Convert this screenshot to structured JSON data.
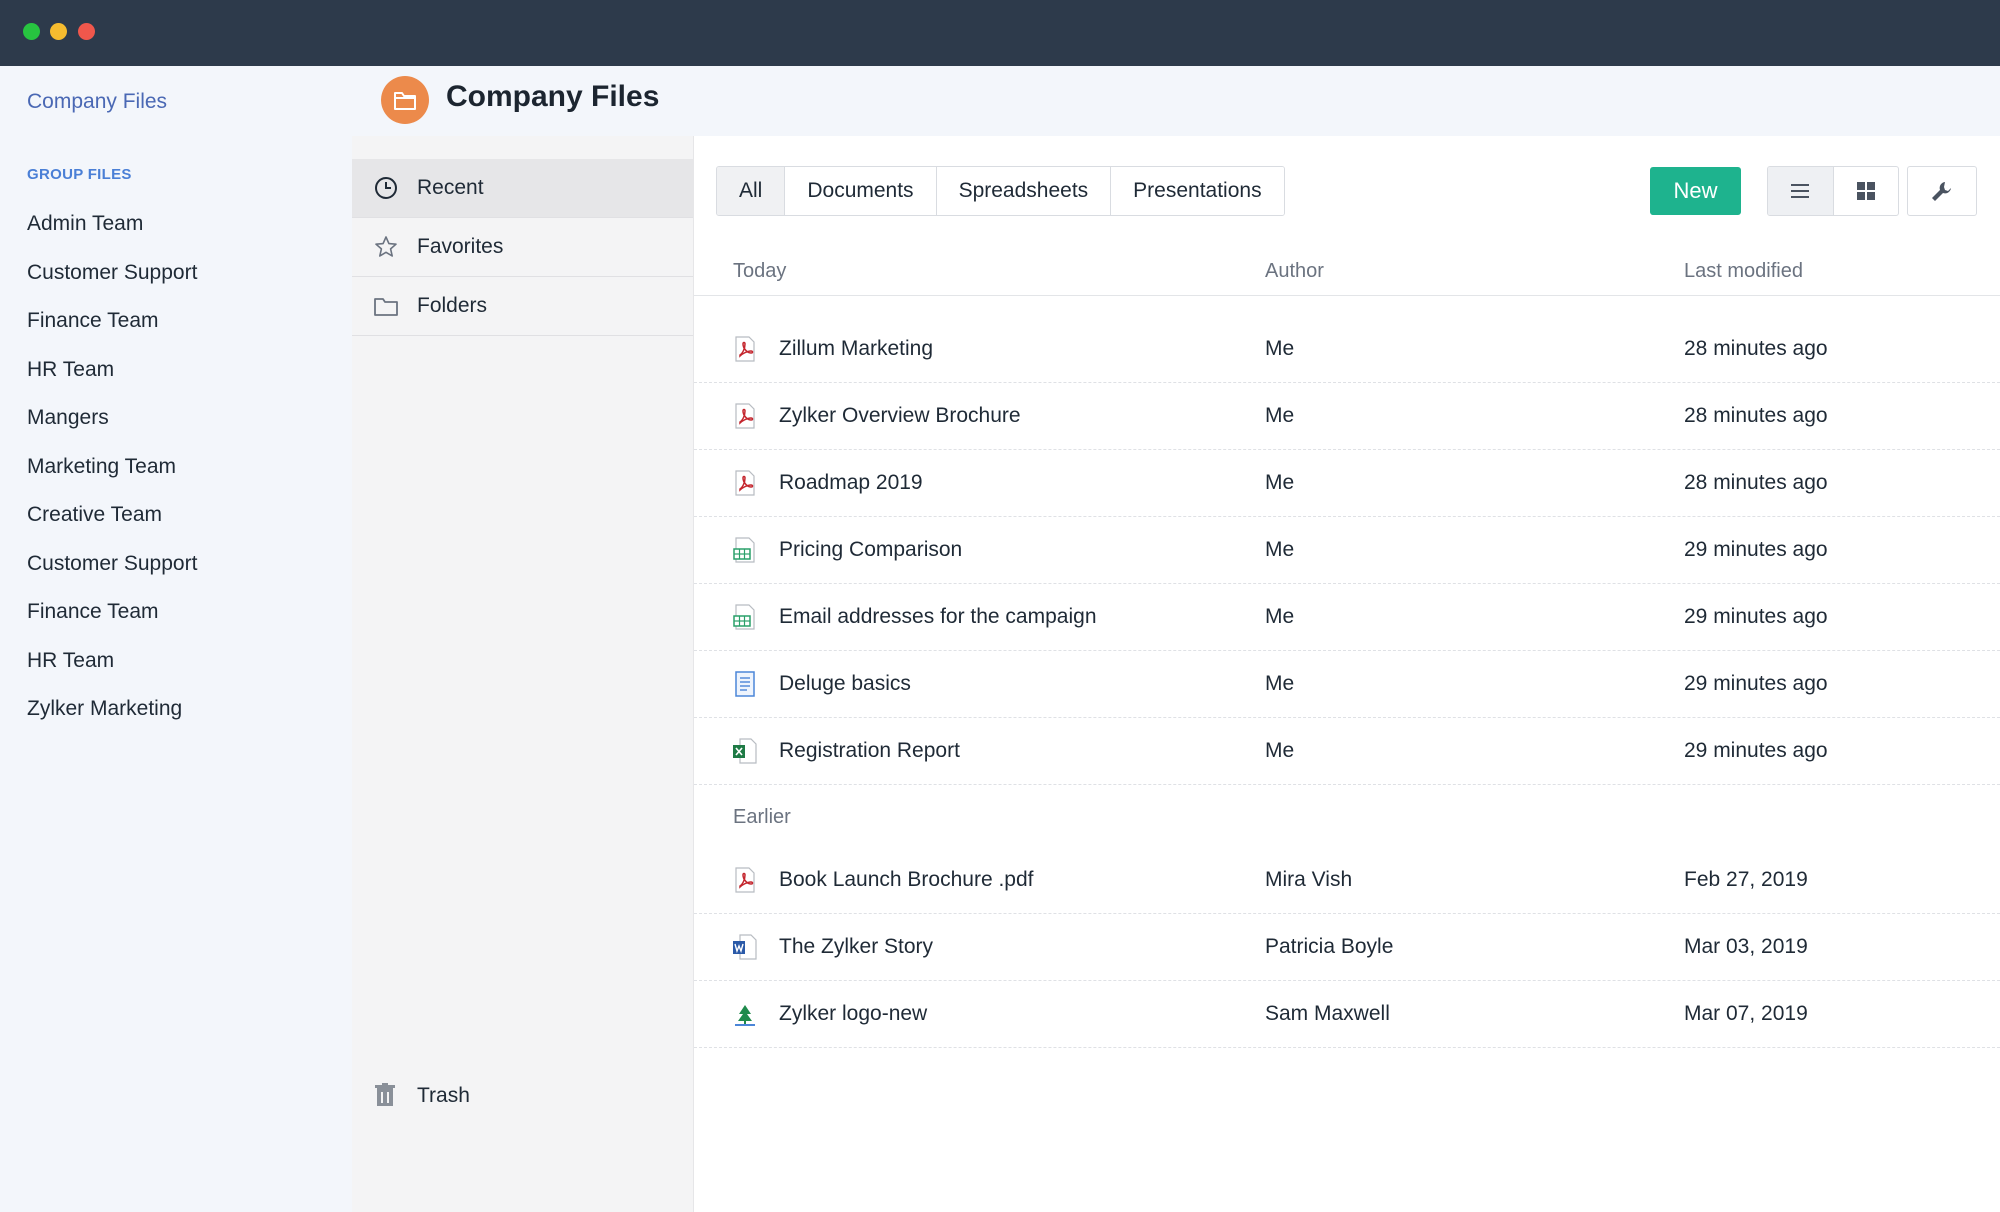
{
  "window": {
    "controls": [
      "close",
      "minimize",
      "maximize"
    ]
  },
  "sidebar": {
    "brand": "Company Files",
    "group_title": "GROUP FILES",
    "items": [
      {
        "label": "Admin Team"
      },
      {
        "label": "Customer Support"
      },
      {
        "label": "Finance Team"
      },
      {
        "label": "HR Team"
      },
      {
        "label": "Mangers"
      },
      {
        "label": "Marketing Team"
      },
      {
        "label": "Creative Team"
      },
      {
        "label": "Customer Support"
      },
      {
        "label": "Finance Team"
      },
      {
        "label": "HR Team"
      },
      {
        "label": "Zylker Marketing"
      }
    ]
  },
  "header": {
    "title": "Company Files",
    "icon": "folder-icon",
    "accent": "#ec8a4b"
  },
  "midnav": {
    "items": [
      {
        "label": "Recent",
        "icon": "clock-icon",
        "active": true
      },
      {
        "label": "Favorites",
        "icon": "star-icon",
        "active": false
      },
      {
        "label": "Folders",
        "icon": "folder-icon",
        "active": false
      }
    ],
    "trash": {
      "label": "Trash",
      "icon": "trash-icon"
    }
  },
  "toolbar": {
    "tabs": [
      {
        "label": "All",
        "active": true
      },
      {
        "label": "Documents",
        "active": false
      },
      {
        "label": "Spreadsheets",
        "active": false
      },
      {
        "label": "Presentations",
        "active": false
      }
    ],
    "new_label": "New",
    "new_color": "#1eb38e",
    "view_modes": [
      "list-view-icon",
      "grid-view-icon"
    ],
    "settings_icon": "wrench-icon"
  },
  "table": {
    "columns": {
      "name": "Today",
      "author": "Author",
      "modified": "Last modified"
    },
    "sections": [
      {
        "label": "Today",
        "rows": [
          {
            "name": "Zillum Marketing",
            "author": "Me",
            "modified": "28 minutes ago",
            "icon": "pdf-file-icon"
          },
          {
            "name": "Zylker Overview Brochure",
            "author": "Me",
            "modified": "28 minutes ago",
            "icon": "pdf-file-icon"
          },
          {
            "name": "Roadmap 2019",
            "author": "Me",
            "modified": "28 minutes ago",
            "icon": "pdf-file-icon"
          },
          {
            "name": "Pricing Comparison",
            "author": "Me",
            "modified": "29 minutes ago",
            "icon": "spreadsheet-file-icon"
          },
          {
            "name": "Email addresses for the campaign",
            "author": "Me",
            "modified": "29 minutes ago",
            "icon": "spreadsheet-file-icon"
          },
          {
            "name": "Deluge basics",
            "author": "Me",
            "modified": "29 minutes ago",
            "icon": "document-file-icon"
          },
          {
            "name": "Registration Report",
            "author": "Me",
            "modified": "29 minutes ago",
            "icon": "excel-file-icon"
          }
        ]
      },
      {
        "label": "Earlier",
        "rows": [
          {
            "name": "Book Launch Brochure .pdf",
            "author": "Mira Vish",
            "modified": "Feb 27, 2019",
            "icon": "pdf-file-icon"
          },
          {
            "name": "The Zylker Story",
            "author": "Patricia Boyle",
            "modified": "Mar 03, 2019",
            "icon": "word-file-icon"
          },
          {
            "name": "Zylker logo-new",
            "author": "Sam Maxwell",
            "modified": "Mar 07, 2019",
            "icon": "image-file-icon"
          }
        ]
      }
    ]
  }
}
